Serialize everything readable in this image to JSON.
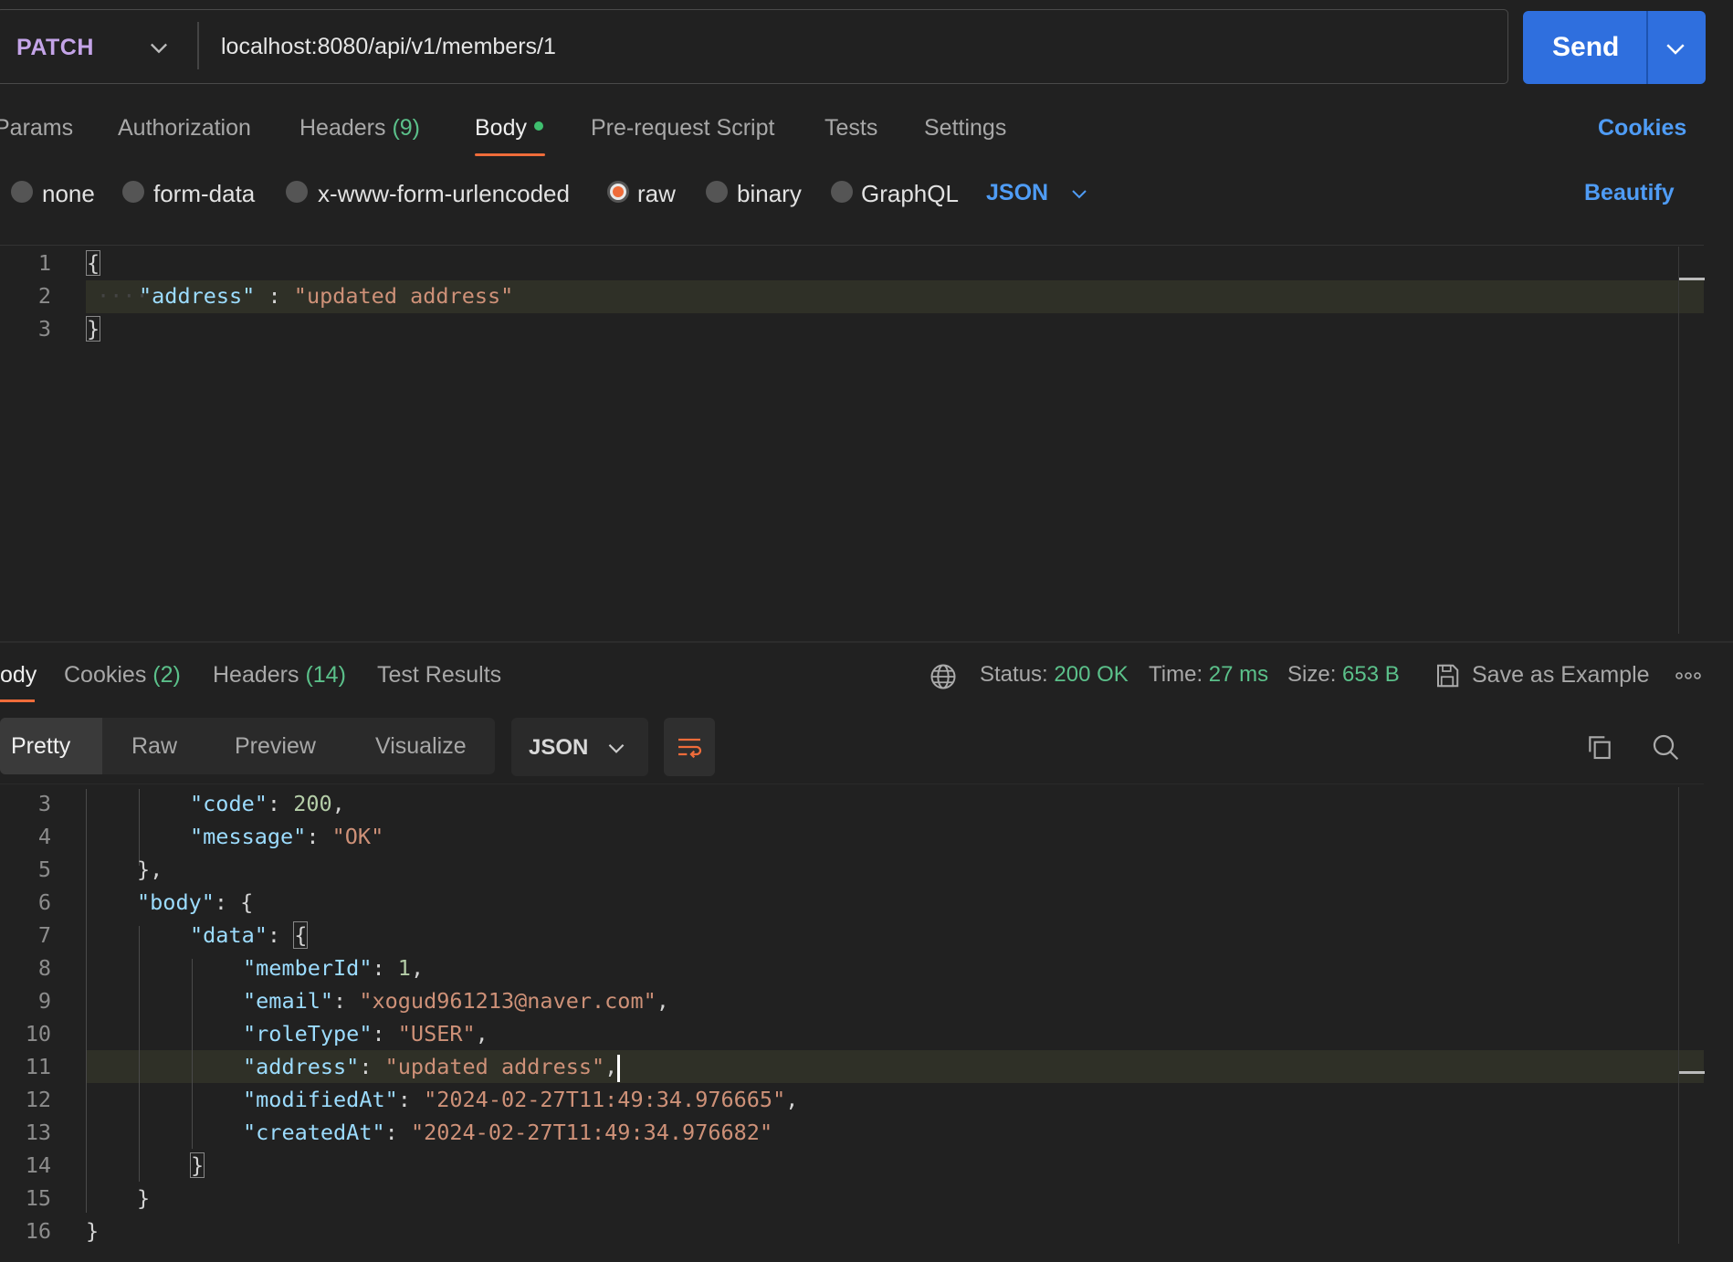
{
  "request": {
    "method": "PATCH",
    "url": "localhost:8080/api/v1/members/1",
    "send_label": "Send"
  },
  "request_tabs": [
    {
      "label": "Params",
      "count": ""
    },
    {
      "label": "Authorization",
      "count": ""
    },
    {
      "label": "Headers",
      "count": "(9)"
    },
    {
      "label": "Body",
      "count": ""
    },
    {
      "label": "Pre-request Script",
      "count": ""
    },
    {
      "label": "Tests",
      "count": ""
    },
    {
      "label": "Settings",
      "count": ""
    }
  ],
  "cookies_link": "Cookies",
  "body_types": [
    "none",
    "form-data",
    "x-www-form-urlencoded",
    "raw",
    "binary",
    "GraphQL"
  ],
  "body_selected": "raw",
  "body_format": "JSON",
  "beautify_label": "Beautify",
  "request_body": {
    "line_numbers": [
      "1",
      "2",
      "3"
    ],
    "open_brace": "{",
    "key": "\"address\"",
    "sep": " : ",
    "value": "\"updated address\"",
    "close_brace": "}"
  },
  "response_tabs": [
    {
      "label": "ody",
      "count": ""
    },
    {
      "label": "Cookies",
      "count": "(2)"
    },
    {
      "label": "Headers",
      "count": "(14)"
    },
    {
      "label": "Test Results",
      "count": ""
    }
  ],
  "response_status": {
    "status_label": "Status:",
    "status_value": "200 OK",
    "time_label": "Time:",
    "time_value": "27 ms",
    "size_label": "Size:",
    "size_value": "653 B",
    "save_example": "Save as Example"
  },
  "view_modes": [
    "Pretty",
    "Raw",
    "Preview",
    "Visualize"
  ],
  "response_format": "JSON",
  "response_body": {
    "line_numbers": [
      "3",
      "4",
      "5",
      "6",
      "7",
      "8",
      "9",
      "10",
      "11",
      "12",
      "13",
      "14",
      "15",
      "16"
    ],
    "code_key": "\"code\"",
    "code_value": "200",
    "message_key": "\"message\"",
    "message_value": "\"OK\"",
    "body_key": "\"body\"",
    "data_key": "\"data\"",
    "memberId_key": "\"memberId\"",
    "memberId_value": "1",
    "email_key": "\"email\"",
    "email_value": "\"xogud961213@naver.com\"",
    "roleType_key": "\"roleType\"",
    "roleType_value": "\"USER\"",
    "address_key": "\"address\"",
    "address_value": "\"updated address\"",
    "modifiedAt_key": "\"modifiedAt\"",
    "modifiedAt_value": "\"2024-02-27T11:49:34.976665\"",
    "createdAt_key": "\"createdAt\"",
    "createdAt_value": "\"2024-02-27T11:49:34.976682\""
  },
  "colors": {
    "accent": "#2f6fde",
    "tab_indicator": "#ef6c3a",
    "link": "#4f9cf5",
    "success": "#5bc08a",
    "method": "#c4a4e8"
  }
}
